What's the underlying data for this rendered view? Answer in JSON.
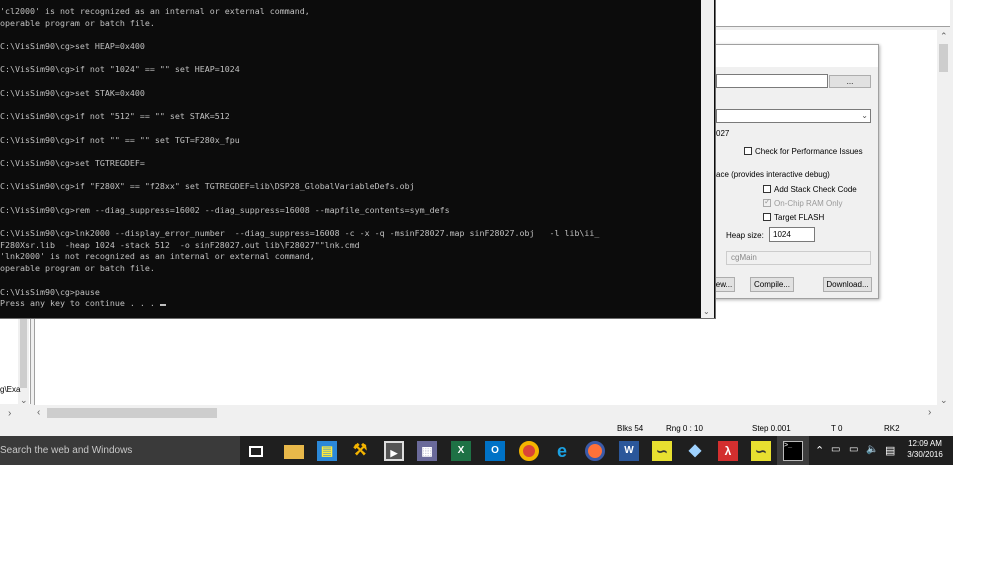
{
  "console": {
    "lines": [
      "'cl2000' is not recognized as an internal or external command,",
      "operable program or batch file.",
      "",
      "C:\\VisSim90\\cg>set HEAP=0x400",
      "",
      "C:\\VisSim90\\cg>if not \"1024\" == \"\" set HEAP=1024",
      "",
      "C:\\VisSim90\\cg>set STAK=0x400",
      "",
      "C:\\VisSim90\\cg>if not \"512\" == \"\" set STAK=512",
      "",
      "C:\\VisSim90\\cg>if not \"\" == \"\" set TGT=F280x_fpu",
      "",
      "C:\\VisSim90\\cg>set TGTREGDEF=",
      "",
      "C:\\VisSim90\\cg>if \"F280X\" == \"f28xx\" set TGTREGDEF=lib\\DSP28_GlobalVariableDefs.obj",
      "",
      "C:\\VisSim90\\cg>rem --diag_suppress=16002 --diag_suppress=16008 --mapfile_contents=sym_defs",
      "",
      "C:\\VisSim90\\cg>lnk2000 --display_error_number  --diag_suppress=16008 -c -x -q -msinF28027.map sinF28027.obj   -l lib\\ii_",
      "F280Xsr.lib  -heap 1024 -stack 512  -o sinF28027.out lib\\F28027\"\"lnk.cmd",
      "'lnk2000' is not recognized as an internal or external command,",
      "operable program or batch file.",
      "",
      "C:\\VisSim90\\cg>pause",
      "Press any key to continue . . . "
    ]
  },
  "dialog": {
    "browse_label": "...",
    "text_027": "027",
    "perf_label": "Check for Performance Issues",
    "interactive_label": "ace (provides interactive debug)",
    "stack_check_label": "Add Stack Check Code",
    "onchip_label": "On-Chip RAM Only",
    "target_flash_label": "Target FLASH",
    "heap_label": "Heap size:",
    "heap_value": "1024",
    "entry_value": "cgMain",
    "preview_label": "ew...",
    "compile_label": "Compile...",
    "download_label": "Download..."
  },
  "left_panel": {
    "text": "g\\Exa"
  },
  "statusbar": {
    "blks": "Blks  54",
    "rng": "Rng  0 : 10",
    "step": "Step  0.001",
    "t": "T  0",
    "rk": "RK2"
  },
  "taskbar": {
    "search_placeholder": "Search the web and Windows",
    "time": "12:09 AM",
    "date": "3/30/2016"
  },
  "colors": {
    "console_bg": "#0c0c0c",
    "console_fg": "#c0c0c0",
    "taskbar_bg": "#1f1f1f"
  }
}
